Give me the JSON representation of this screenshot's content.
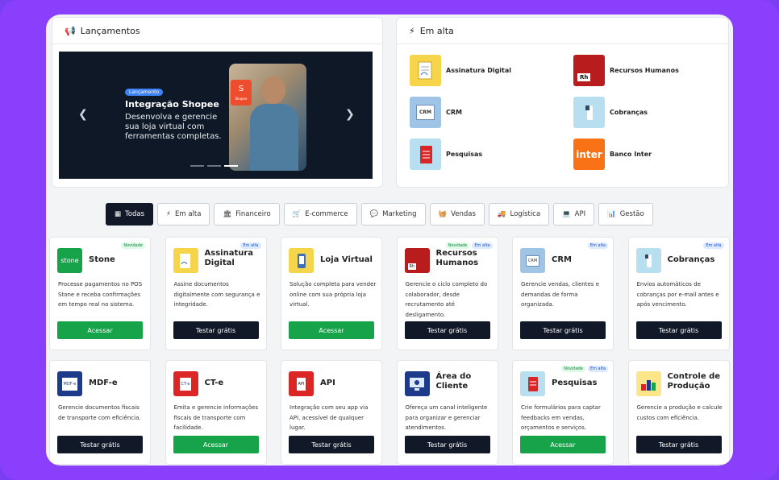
{
  "launch": {
    "title": "Lançamentos",
    "slide": {
      "badge": "Lançamento",
      "title": "Integração Shopee",
      "text": "Desenvolva e gerencie sua loja virtual com ferramentas completas.",
      "logo_text": "Shopee"
    }
  },
  "trend": {
    "title": "Em alta",
    "items": [
      {
        "label": "Assinatura Digital",
        "icon": "signature-icon"
      },
      {
        "label": "Recursos Humanos",
        "icon": "hr-icon"
      },
      {
        "label": "CRM",
        "icon": "crm-icon"
      },
      {
        "label": "Cobranças",
        "icon": "billing-icon"
      },
      {
        "label": "Pesquisas",
        "icon": "survey-icon"
      },
      {
        "label": "Banco Inter",
        "icon": "bank-icon"
      }
    ]
  },
  "filters": [
    "Todas",
    "Em alta",
    "Financeiro",
    "E-commerce",
    "Marketing",
    "Vendas",
    "Logística",
    "API",
    "Gestão"
  ],
  "apps": [
    {
      "name": "Stone",
      "desc": "Processe pagamentos no POS Stone e receba confirmações em tempo real no sistema.",
      "button": "Acessar",
      "badges": [
        "Novidade"
      ],
      "tile_text": "stone"
    },
    {
      "name": "Assinatura Digital",
      "desc": "Assine documentos digitalmente com segurança e integridade.",
      "button": "Testar grátis",
      "badges": [
        "Em alta"
      ]
    },
    {
      "name": "Loja Virtual",
      "desc": "Solução completa para vender online com sua própria loja virtual.",
      "button": "Acessar",
      "badges": []
    },
    {
      "name": "Recursos Humanos",
      "desc": "Gerencie o ciclo completo do colaborador, desde recrutamento até desligamento.",
      "button": "Testar grátis",
      "badges": [
        "Novidade",
        "Em alta"
      ],
      "tile_text": "Rh"
    },
    {
      "name": "CRM",
      "desc": "Gerencie vendas, clientes e demandas de forma organizada.",
      "button": "Testar grátis",
      "badges": [
        "Em alta"
      ],
      "tile_text": "CRM"
    },
    {
      "name": "Cobranças",
      "desc": "Envios automáticos de cobranças por e-mail antes e após vencimento.",
      "button": "Testar grátis",
      "badges": [
        "Em alta"
      ]
    },
    {
      "name": "MDF-e",
      "desc": "Gerencie documentos fiscais de transporte com eficiência.",
      "button": "Testar grátis",
      "badges": [],
      "tile_text": "MDF-e"
    },
    {
      "name": "CT-e",
      "desc": "Emita e gerencie informações fiscais de transporte com facilidade.",
      "button": "Acessar",
      "badges": [],
      "tile_text": "CT-e"
    },
    {
      "name": "API",
      "desc": "Integração com seu app via API, acessível de qualquer lugar.",
      "button": "Testar grátis",
      "badges": [],
      "tile_text": "API"
    },
    {
      "name": "Área do Cliente",
      "desc": "Ofereça um canal inteligente para organizar e gerenciar atendimentos.",
      "button": "Testar grátis",
      "badges": []
    },
    {
      "name": "Pesquisas",
      "desc": "Crie formulários para captar feedbacks em vendas, orçamentos e serviços.",
      "button": "Acessar",
      "badges": [
        "Novidade",
        "Em alta"
      ]
    },
    {
      "name": "Controle de Produção",
      "desc": "Gerencie a produção e calcule custos com eficiência.",
      "button": "Testar grátis",
      "badges": []
    }
  ],
  "trend_tile_texts": {
    "hr": "Rh",
    "crm": "CRM",
    "bank": "inter"
  }
}
